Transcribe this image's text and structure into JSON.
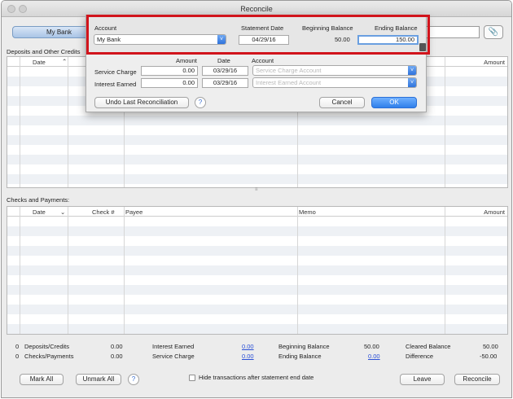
{
  "window": {
    "title": "Reconcile"
  },
  "toolbar": {
    "account_button": "My Bank"
  },
  "deposits": {
    "label": "Deposits and Other Credits",
    "columns": {
      "date": "Date",
      "amount": "Amount"
    }
  },
  "checks": {
    "label": "Checks and Payments:",
    "columns": {
      "date": "Date",
      "check": "Check #",
      "payee": "Payee",
      "memo": "Memo",
      "amount": "Amount"
    }
  },
  "summary": {
    "deposits_count": "0",
    "deposits_label": "Deposits/Credits",
    "deposits_value": "0.00",
    "checks_count": "0",
    "checks_label": "Checks/Payments",
    "checks_value": "0.00",
    "interest_label": "Interest Earned",
    "interest_value": "0.00",
    "service_label": "Service Charge",
    "service_value": "0.00",
    "beginning_label": "Beginning Balance",
    "beginning_value": "50.00",
    "ending_label": "Ending Balance",
    "ending_value": "0.00",
    "cleared_label": "Cleared Balance",
    "cleared_value": "50.00",
    "difference_label": "Difference",
    "difference_value": "-50.00"
  },
  "footer": {
    "mark_all": "Mark All",
    "unmark_all": "Unmark All",
    "help": "?",
    "hide_label": "Hide transactions after statement end date",
    "leave": "Leave",
    "reconcile": "Reconcile"
  },
  "sheet": {
    "account_label": "Account",
    "account_value": "My Bank",
    "statement_date_label": "Statement Date",
    "statement_date_value": "04/29/16",
    "beginning_balance_label": "Beginning Balance",
    "beginning_balance_value": "50.00",
    "ending_balance_label": "Ending Balance",
    "ending_balance_value": "150.00",
    "amount_header": "Amount",
    "date_header": "Date",
    "account_header": "Account",
    "service_charge_label": "Service Charge",
    "service_charge_amount": "0.00",
    "service_charge_date": "03/29/16",
    "service_charge_account_placeholder": "Service Charge Account",
    "interest_earned_label": "Interest Earned",
    "interest_earned_amount": "0.00",
    "interest_earned_date": "03/29/16",
    "interest_earned_account_placeholder": "Interest Earned Account",
    "undo_button": "Undo Last Reconciliation",
    "help": "?",
    "cancel_button": "Cancel",
    "ok_button": "OK"
  },
  "colors": {
    "highlight": "#d1141c",
    "accent": "#2f7fea",
    "link": "#2a4fd6"
  }
}
